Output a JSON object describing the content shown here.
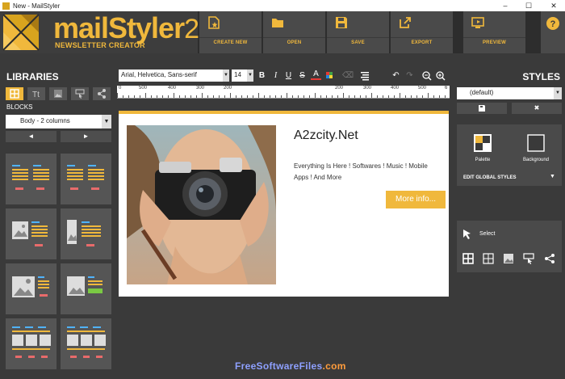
{
  "window": {
    "title": "New - MailStyler",
    "buttons": [
      "–",
      "☐",
      "✕"
    ]
  },
  "logo": {
    "word": "mailStyler",
    "version": "2",
    "subtitle": "NEWSLETTER CREATOR"
  },
  "toolbar": {
    "create_new": "CREATE NEW",
    "open": "OPEN",
    "save": "SAVE",
    "export": "EXPORT",
    "preview": "PREVIEW",
    "help": "?"
  },
  "libraries": {
    "title": "LIBRARIES",
    "blocks_label": "BLOCKS",
    "blocks_select": "Body - 2 columns",
    "prev": "◄",
    "next": "►"
  },
  "format": {
    "font": "Arial, Helvetica, Sans-serif",
    "size": "14",
    "bold": "B",
    "italic": "I",
    "underline": "U",
    "strike": "S",
    "color": "A"
  },
  "ruler": {
    "ticks": [
      "0",
      "500",
      "400",
      "300",
      "200",
      "200",
      "300",
      "400",
      "500",
      "6"
    ]
  },
  "email": {
    "title": "A2zcity.Net",
    "body": "Everything Is Here ! Softwares ! Music ! Mobile Apps ! And More",
    "button": "More info..."
  },
  "styles": {
    "title": "STYLES",
    "selected": "(default)",
    "save_icon": "💾",
    "delete_icon": "✖",
    "palette": "Palette",
    "background": "Background",
    "edit_global": "EDIT GLOBAL STYLES",
    "select": "Select"
  },
  "watermark": {
    "part1": "FreeSoftwareFiles",
    "part2": ".com"
  },
  "colors": {
    "accent": "#f0b83c",
    "panel": "#3a3a3a",
    "button": "#4a4a4a"
  }
}
